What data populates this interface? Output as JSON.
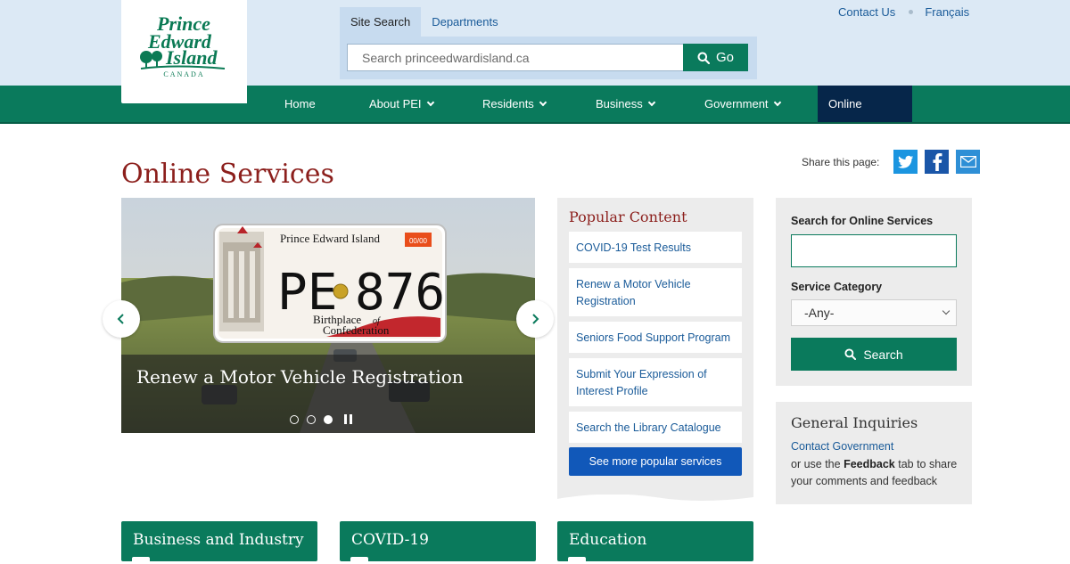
{
  "header": {
    "logo_alt": "Prince Edward Island",
    "logo_subtitle": "CANADA",
    "search_tabs": [
      {
        "label": "Site Search",
        "active": true
      },
      {
        "label": "Departments",
        "active": false
      }
    ],
    "search_placeholder": "Search princeedwardisland.ca",
    "search_button": "Go",
    "top_links": [
      "Contact Us",
      "Français"
    ]
  },
  "nav": {
    "items": [
      {
        "label": "Home",
        "has_dropdown": false
      },
      {
        "label": "About PEI",
        "has_dropdown": true
      },
      {
        "label": "Residents",
        "has_dropdown": true
      },
      {
        "label": "Business",
        "has_dropdown": true
      },
      {
        "label": "Government",
        "has_dropdown": true
      },
      {
        "label": "Online Services",
        "has_dropdown": false,
        "active": true
      }
    ]
  },
  "page": {
    "title": "Online Services",
    "share_label": "Share this page:",
    "share_icons": [
      "twitter-icon",
      "facebook-icon",
      "email-icon"
    ]
  },
  "carousel": {
    "caption": "Renew a Motor Vehicle Registration",
    "plate": {
      "province": "Prince Edward Island",
      "number_left": "PE",
      "number_right": "876",
      "slogan_1": "Birthplace",
      "slogan_of": "of",
      "slogan_2": "Confederation",
      "sticker": "00/00"
    },
    "slide_count": 3,
    "active_slide": 3
  },
  "popular": {
    "heading": "Popular Content",
    "links": [
      "COVID-19 Test Results",
      "Renew a Motor Vehicle Registration",
      "Seniors Food Support Program",
      "Submit Your Expression of Interest Profile",
      "Search the Library Catalogue"
    ],
    "see_more": "See more popular services"
  },
  "service_search": {
    "search_label": "Search for Online Services",
    "search_value": "",
    "category_label": "Service Category",
    "category_selected": "-Any-",
    "button": "Search"
  },
  "inquiries": {
    "heading": "General Inquiries",
    "link": "Contact Government",
    "text_prefix": "or use the ",
    "text_bold": "Feedback",
    "text_suffix": " tab to share your comments and feedback"
  },
  "tiles": [
    "Business and Industry",
    "COVID-19",
    "Education"
  ],
  "colors": {
    "brand_green": "#0a7a5c",
    "title_red": "#8c1f1c",
    "link_blue": "#1a5b99",
    "nav_active_navy": "#06264a",
    "button_blue": "#1158b9",
    "header_blue": "#dce9f5"
  }
}
